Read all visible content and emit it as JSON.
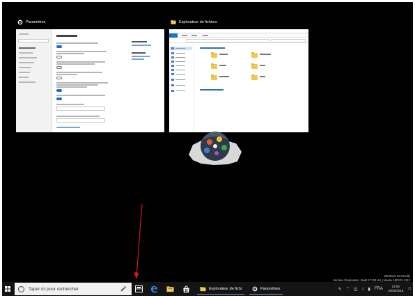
{
  "task_view": {
    "windows": [
      {
        "title": "Paramètres"
      },
      {
        "title": "Explorateur de fichiers"
      }
    ]
  },
  "watermark": {
    "line1": "Windows 10 Famille",
    "line2": "Version d'évaluation. Build 17133.rs4_release.180323-1312"
  },
  "taskbar": {
    "search_placeholder": "Taper ici pour rechercher",
    "apps": [
      {
        "label": "Explorateur de fichi"
      },
      {
        "label": "Paramètres"
      }
    ],
    "tray": {
      "language": "FRA",
      "time": "13:09",
      "date": "15/05/2018"
    }
  },
  "colors": {
    "accent": "#1a6fd1",
    "annotation_arrow": "#d21a1a",
    "taskbar": "#141414"
  }
}
